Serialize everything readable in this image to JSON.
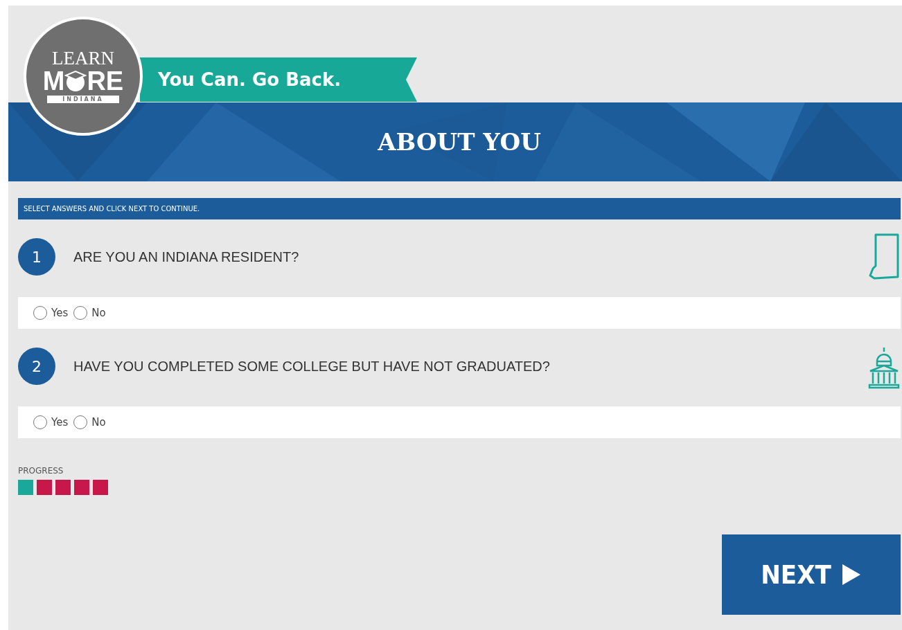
{
  "logo": {
    "top": "LEARN",
    "middle_start": "M",
    "middle_end": "RE",
    "bottom": "INDIANA"
  },
  "ribbon": {
    "text": "You Can. Go Back."
  },
  "header": {
    "title": "ABOUT YOU"
  },
  "instructions": "SELECT ANSWERS AND CLICK NEXT TO CONTINUE.",
  "questions": [
    {
      "number": "1",
      "text": "ARE YOU AN INDIANA RESIDENT?",
      "kind": "state",
      "options": [
        {
          "label": "Yes",
          "selected": false
        },
        {
          "label": "No",
          "selected": false
        }
      ]
    },
    {
      "number": "2",
      "text": "HAVE YOU COMPLETED SOME COLLEGE BUT HAVE NOT GRADUATED?",
      "kind": "college",
      "options": [
        {
          "label": "Yes",
          "selected": false
        },
        {
          "label": "No",
          "selected": false
        }
      ]
    }
  ],
  "progress": {
    "label": "PROGRESS",
    "steps": [
      {
        "color": "#1aa89a"
      },
      {
        "color": "#c8174a"
      },
      {
        "color": "#c8174a"
      },
      {
        "color": "#c8174a"
      },
      {
        "color": "#c8174a"
      }
    ]
  },
  "next_button": {
    "label": "NEXT"
  }
}
